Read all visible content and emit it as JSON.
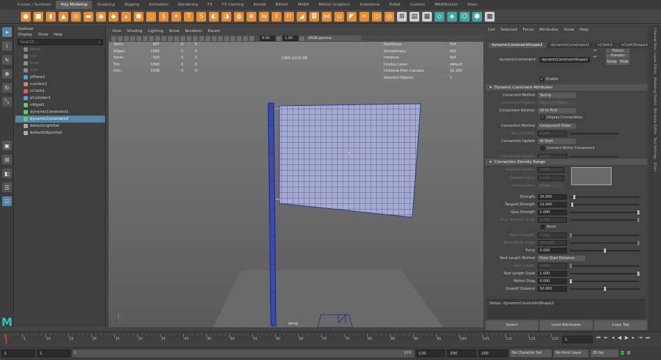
{
  "shelf": {
    "tabs": [
      "Curves / Surfaces",
      "Poly Modeling",
      "Sculpting",
      "Rigging",
      "Animation",
      "Rendering",
      "FX",
      "FX Caching",
      "Arnold",
      "Bifrost",
      "MASH",
      "Motion Graphics",
      "Substance",
      "Bullet",
      "Custom",
      "MASHtoLink",
      "XGen"
    ],
    "active_tab": "Poly Modeling"
  },
  "outliner": {
    "title": "Outliner",
    "menu": [
      "Display",
      "Show",
      "Help"
    ],
    "search_placeholder": "Search...",
    "items": [
      {
        "label": "persp",
        "dim": true,
        "color": "#888"
      },
      {
        "label": "top",
        "dim": true,
        "color": "#888"
      },
      {
        "label": "front",
        "dim": true,
        "color": "#888"
      },
      {
        "label": "side",
        "dim": true,
        "color": "#888"
      },
      {
        "label": "pPlane1",
        "dim": false,
        "color": "#4aa3df"
      },
      {
        "label": "nucleus1",
        "dim": false,
        "color": "#c86"
      },
      {
        "label": "nCloth1",
        "dim": false,
        "color": "#e55"
      },
      {
        "label": "pCylinder1",
        "dim": false,
        "color": "#4aa3df"
      },
      {
        "label": "nRigid1",
        "dim": false,
        "color": "#6c6"
      },
      {
        "label": "dynamicConstraint1",
        "dim": false,
        "color": "#6c6"
      },
      {
        "label": "dynamicConstraint2",
        "dim": false,
        "color": "#6c6",
        "selected": true
      },
      {
        "label": "defaultLightSet",
        "dim": false,
        "color": "#aaa"
      },
      {
        "label": "defaultObjectSet",
        "dim": false,
        "color": "#aaa"
      }
    ]
  },
  "viewport": {
    "menu": [
      "View",
      "Shading",
      "Lighting",
      "Show",
      "Renderer",
      "Panels"
    ],
    "exposure": "0.00",
    "gamma": "1.00",
    "color_space": "sRGB gamma",
    "caps_lock": "CAPS LOCK ON",
    "camera_label": "persp",
    "hud_left": [
      {
        "label": "Verts:",
        "a": "947",
        "b": "0",
        "c": "0"
      },
      {
        "label": "Edges:",
        "a": "1864",
        "b": "0",
        "c": "0"
      },
      {
        "label": "Faces:",
        "a": "920",
        "b": "0",
        "c": "0"
      },
      {
        "label": "Tris:",
        "a": "1800",
        "b": "0",
        "c": "0"
      },
      {
        "label": "UVs:",
        "a": "1008",
        "b": "0",
        "c": "0"
      }
    ],
    "hud_right": [
      {
        "label": "Backfaces:",
        "value": "N/A"
      },
      {
        "label": "Smoothness:",
        "value": "N/A"
      },
      {
        "label": "Instance:",
        "value": "N/A"
      },
      {
        "label": "Display Layer:",
        "value": "default"
      },
      {
        "label": "Distance From Camera:",
        "value": "42.185"
      },
      {
        "label": "Selected Objects:",
        "value": "1"
      }
    ]
  },
  "attr": {
    "menu": [
      "List",
      "Selected",
      "Focus",
      "Attributes",
      "Show",
      "Help"
    ],
    "tabs": [
      "dynamicConstraintShape2",
      "dynamicConstraint2",
      "nCloth1",
      "nClothShape1"
    ],
    "node_label": "dynamicConstraint:",
    "node_value": "dynamicConstraintShape2",
    "focus": "Focus",
    "presets": "Presets",
    "show": "Show",
    "hide": "Hide",
    "enable": "Enable",
    "section1": "Dynamic Constraint Attributes",
    "section2": "Connection Density Range",
    "rows": [
      {
        "label": "Constraint Method",
        "type": "drop",
        "value": "Spring",
        "dim": false
      },
      {
        "label": "Constraint Relation",
        "type": "drop",
        "value": "Object to Object",
        "dim": true
      },
      {
        "label": "Component Relation",
        "type": "drop",
        "value": "All to First",
        "dim": false
      },
      {
        "label": "Display Connections",
        "type": "check",
        "value": "",
        "dim": false,
        "checked": true
      },
      {
        "label": "Connection Method",
        "type": "drop",
        "value": "Component Order",
        "dim": false
      },
      {
        "label": "Max Distance",
        "type": "field",
        "value": "0.100",
        "dim": true
      },
      {
        "label": "Connection Update",
        "type": "drop",
        "value": "At Start",
        "dim": false
      },
      {
        "label": "Connect Within Component",
        "type": "check",
        "value": "",
        "dim": false,
        "checked": false
      },
      {
        "label": "Connection Density",
        "type": "field",
        "value": "1.000",
        "dim": true
      }
    ],
    "density_rows": [
      {
        "label": "Selected Position",
        "value": "0.000"
      },
      {
        "label": "Selected Value",
        "value": "1.000"
      },
      {
        "label": "Interpolation",
        "value": "Linear"
      }
    ],
    "rows2": [
      {
        "label": "Strength",
        "value": "20.000",
        "dim": false,
        "knob": 0.05
      },
      {
        "label": "Tangent Strength",
        "value": "10.000",
        "dim": false,
        "knob": 0.02
      },
      {
        "label": "Glue Strength",
        "value": "1.000",
        "dim": false,
        "knob": 1.0
      },
      {
        "label": "Glue Strength Scale",
        "value": "1.000",
        "dim": true,
        "knob": 1.0
      },
      {
        "label": "Bend",
        "value": "",
        "dim": false,
        "check": true
      },
      {
        "label": "Bend Strength",
        "value": "0.000",
        "dim": true,
        "knob": 0.0
      },
      {
        "label": "Bend Break Angle",
        "value": "360.000",
        "dim": true,
        "knob": 1.0
      },
      {
        "label": "Force",
        "value": "0.000",
        "dim": false,
        "knob": 0.5
      },
      {
        "label": "Rest Length Method",
        "value": "From Start Distance",
        "dim": false,
        "drop": true
      },
      {
        "label": "Rest Length",
        "value": "0.000",
        "dim": true,
        "knob": 0.0
      },
      {
        "label": "Rest Length Scale",
        "value": "1.000",
        "dim": false,
        "knob": 1.0
      },
      {
        "label": "Motion Drag",
        "value": "0.000",
        "dim": false,
        "knob": 0.0
      },
      {
        "label": "Dropoff Distance",
        "value": "50.000",
        "dim": false,
        "knob": 0.5
      }
    ],
    "notes": "Notes: dynamicConstraintShape2",
    "buttons": [
      "Select",
      "Load Attributes",
      "Copy Tab"
    ]
  },
  "side_tabs": [
    "Channel Box / Layer Editor",
    "Modeling Toolkit",
    "Attribute Editor",
    "Tool Settings",
    "XGen"
  ],
  "time": {
    "ticks": [
      "1",
      "5",
      "10",
      "15",
      "20",
      "25",
      "30",
      "35",
      "40",
      "45",
      "50",
      "55",
      "60",
      "65",
      "70",
      "75",
      "80",
      "85",
      "90",
      "95",
      "100",
      "105",
      "110",
      "115",
      "120"
    ],
    "current": "1",
    "start": "1",
    "start2": "1",
    "playback_start": "1",
    "end": "120",
    "end2": "200",
    "end3": "200",
    "character_set": "No Character Set",
    "anim_layer": "No Anim Layer",
    "fps": "25 fps"
  }
}
